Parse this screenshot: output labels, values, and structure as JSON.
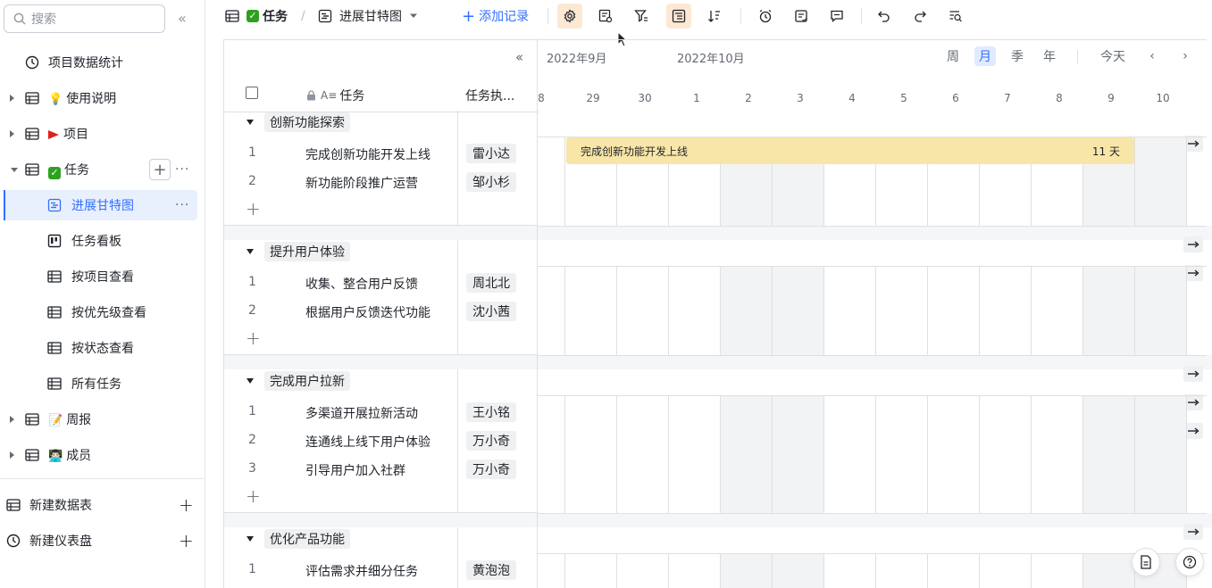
{
  "sidebar": {
    "search_placeholder": "搜索",
    "items": [
      {
        "label": "项目数据统计"
      },
      {
        "label": "使用说明",
        "emoji": "💡"
      },
      {
        "label": "项目"
      },
      {
        "label": "任务"
      },
      {
        "label": "进展甘特图"
      },
      {
        "label": "任务看板"
      },
      {
        "label": "按项目查看"
      },
      {
        "label": "按优先级查看"
      },
      {
        "label": "按状态查看"
      },
      {
        "label": "所有任务"
      },
      {
        "label": "周报",
        "emoji": "📝"
      },
      {
        "label": "成员",
        "emoji": "👨🏻‍💻"
      }
    ],
    "new_table": "新建数据表",
    "new_dashboard": "新建仪表盘"
  },
  "toolbar": {
    "table_name": "任务",
    "view_name": "进展甘特图",
    "add_record": "添加记录"
  },
  "grid": {
    "col_task": "任务",
    "col_exec": "任务执..."
  },
  "timeline": {
    "month1": "2022年9月",
    "month2": "2022年10月",
    "views": [
      "周",
      "月",
      "季",
      "年"
    ],
    "selected_view": "月",
    "today": "今天",
    "days": [
      "8",
      "29",
      "30",
      "1",
      "2",
      "3",
      "4",
      "5",
      "6",
      "7",
      "8",
      "9",
      "10"
    ]
  },
  "groups": [
    {
      "title": "创新功能探索",
      "rows": [
        {
          "num": "1",
          "task": "完成创新功能开发上线",
          "exec": "雷小达"
        },
        {
          "num": "2",
          "task": "新功能阶段推广运营",
          "exec": "邹小杉"
        }
      ]
    },
    {
      "title": "提升用户体验",
      "rows": [
        {
          "num": "1",
          "task": "收集、整合用户反馈",
          "exec": "周北北"
        },
        {
          "num": "2",
          "task": "根据用户反馈迭代功能",
          "exec": "沈小茜"
        }
      ]
    },
    {
      "title": "完成用户拉新",
      "rows": [
        {
          "num": "1",
          "task": "多渠道开展拉新活动",
          "exec": "王小铭"
        },
        {
          "num": "2",
          "task": "连通线上线下用户体验",
          "exec": "万小奇"
        },
        {
          "num": "3",
          "task": "引导用户加入社群",
          "exec": "万小奇"
        }
      ]
    },
    {
      "title": "优化产品功能",
      "rows": [
        {
          "num": "1",
          "task": "评估需求并细分任务",
          "exec": "黄泡泡"
        }
      ]
    }
  ],
  "bar": {
    "label": "完成创新功能开发上线",
    "duration": "11 天"
  },
  "colors": {
    "accent": "#3370ff",
    "bar": "#f8e6a8",
    "check": "#2ea121"
  }
}
